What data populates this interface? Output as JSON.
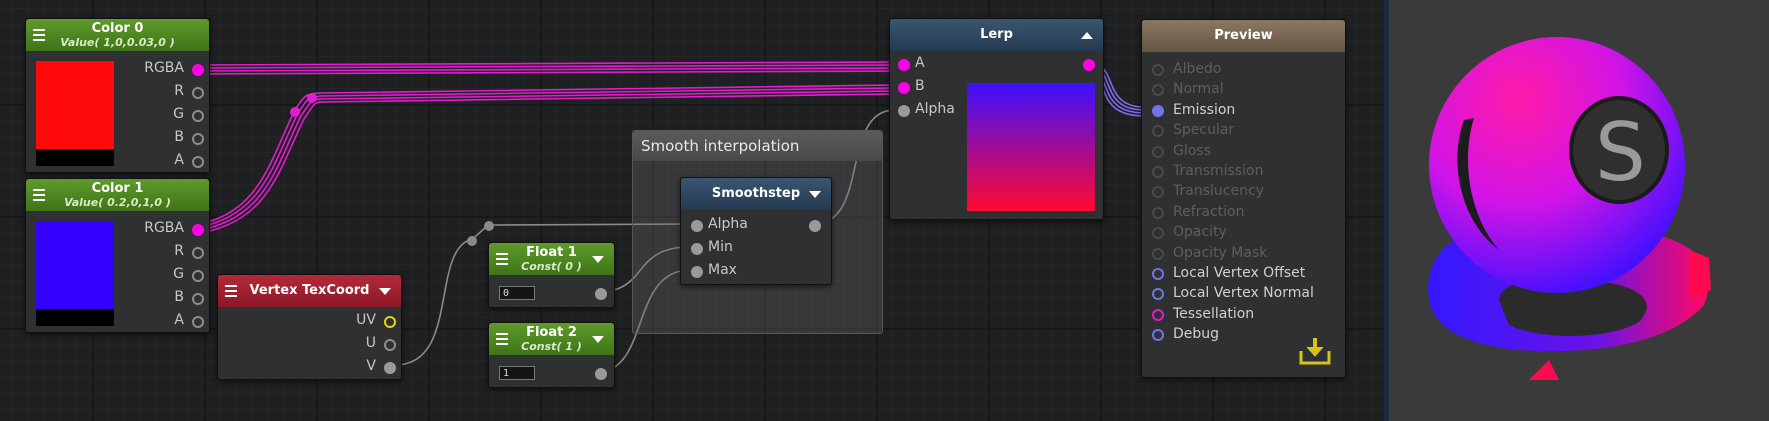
{
  "nodes": {
    "color0": {
      "title": "Color 0",
      "subtitle": "Value( 1,0,0.03,0 )",
      "ports": [
        "RGBA",
        "R",
        "G",
        "B",
        "A"
      ],
      "swatch_color": "#ff0a0c"
    },
    "color1": {
      "title": "Color 1",
      "subtitle": "Value( 0.2,0,1,0 )",
      "ports": [
        "RGBA",
        "R",
        "G",
        "B",
        "A"
      ],
      "swatch_color": "#3300ff"
    },
    "vertex_texcoord": {
      "title": "Vertex TexCoord",
      "ports": [
        "UV",
        "U",
        "V"
      ]
    },
    "float1": {
      "title": "Float 1",
      "subtitle": "Const( 0 )",
      "value": "0"
    },
    "float2": {
      "title": "Float 2",
      "subtitle": "Const( 1 )",
      "value": "1"
    },
    "smoothstep": {
      "title": "Smoothstep",
      "inputs": [
        "Alpha",
        "Min",
        "Max"
      ]
    },
    "lerp": {
      "title": "Lerp",
      "inputs": [
        "A",
        "B",
        "Alpha"
      ]
    }
  },
  "group": {
    "title": "Smooth interpolation"
  },
  "preview": {
    "title": "Preview",
    "inputs": [
      {
        "label": "Albedo",
        "active": false
      },
      {
        "label": "Normal",
        "active": false
      },
      {
        "label": "Emission",
        "active": true,
        "connected": true
      },
      {
        "label": "Specular",
        "active": false
      },
      {
        "label": "Gloss",
        "active": false
      },
      {
        "label": "Transmission",
        "active": false
      },
      {
        "label": "Translucency",
        "active": false
      },
      {
        "label": "Refraction",
        "active": false
      },
      {
        "label": "Opacity",
        "active": false
      },
      {
        "label": "Opacity Mask",
        "active": false
      },
      {
        "label": "Local Vertex Offset",
        "active": true
      },
      {
        "label": "Local Vertex Normal",
        "active": true
      },
      {
        "label": "Tessellation",
        "active": true,
        "magenta": true
      },
      {
        "label": "Debug",
        "active": true
      }
    ]
  },
  "colors": {
    "wire_magenta": "#e21cd0",
    "wire_gray": "#8a8a8a",
    "wire_blue": "#7f6cf0",
    "gradient_top": "#3d10ff",
    "gradient_bottom": "#ff0a30",
    "accent_yellow": "#d6c21c"
  },
  "icons": {
    "menu": "hamburger-icon",
    "dropdown": "triangle-down-icon",
    "collapse": "triangle-up-icon",
    "export": "download-tray-icon",
    "logo": "s-logo-icon"
  }
}
